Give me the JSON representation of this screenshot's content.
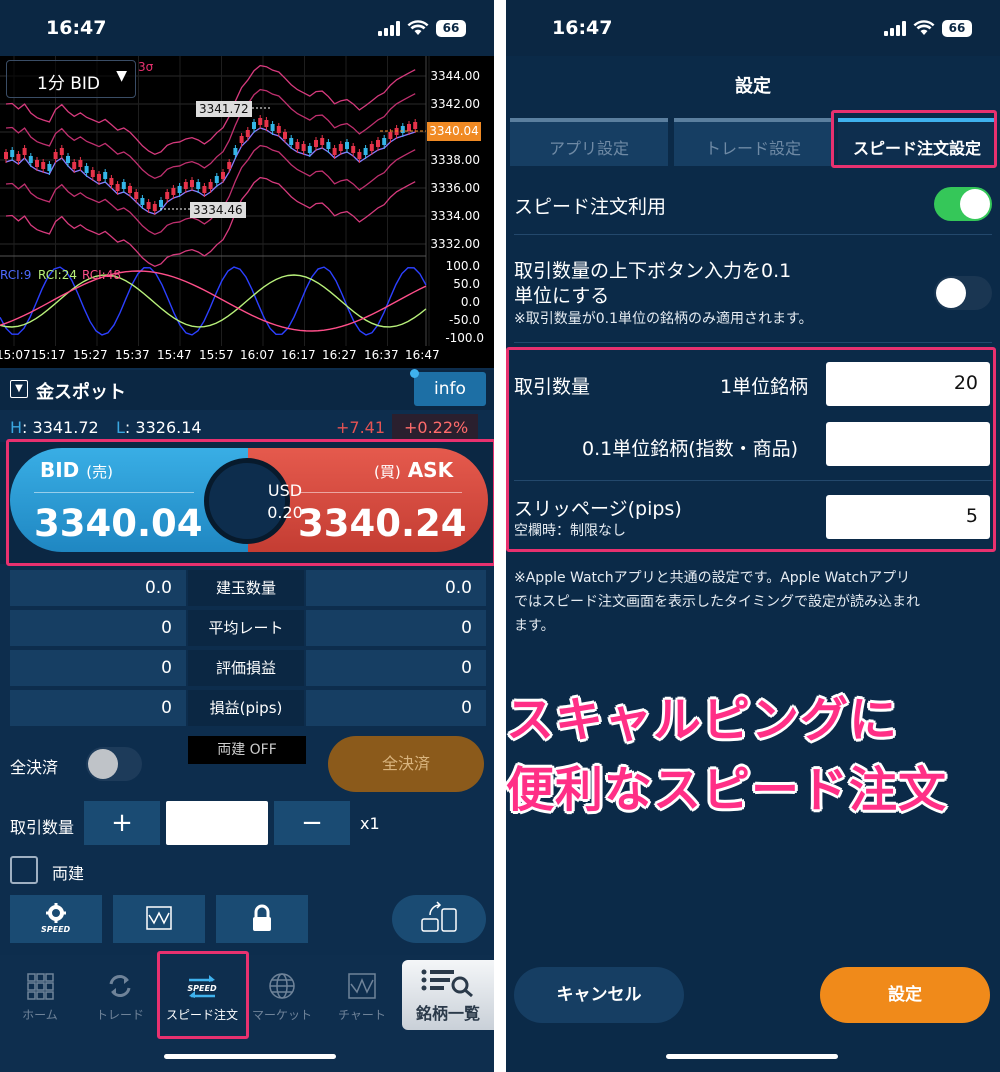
{
  "colors": {
    "bid": "#2a9fd8",
    "ask": "#d94a3e",
    "accent": "#3fb2ee",
    "highlight": "#e8316f",
    "overlay_text": "#ff2f86",
    "toggle_on": "#35c759",
    "confirm": "#f08a1a"
  },
  "left": {
    "status": {
      "time": "16:47",
      "battery": "66"
    },
    "chart": {
      "timeframe": "1分 BID",
      "indicator_label": "3σ",
      "y_ticks": [
        "3344.00",
        "3342.00",
        "3340.00",
        "3338.00",
        "3336.00",
        "3334.00",
        "3332.00"
      ],
      "current": "3340.04",
      "high_label": "3341.72",
      "low_label": "3334.46",
      "rci_ticks": [
        "100.0",
        "50.0",
        "0.0",
        "-50.0",
        "-100.0"
      ],
      "rci_legend": [
        "RCI:9",
        "RCI:24",
        "RCI:48"
      ],
      "x_ticks": [
        "15:07",
        "15:17",
        "15:27",
        "15:37",
        "15:47",
        "15:57",
        "16:07",
        "16:17",
        "16:27",
        "16:37",
        "16:47"
      ]
    },
    "symbol": {
      "name": "金スポット",
      "info": "info"
    },
    "hl": {
      "h_key": "H",
      "h_val": "3341.72",
      "l_key": "L",
      "l_val": "3326.14",
      "change": "+7.41",
      "percent": "+0.22%"
    },
    "quote": {
      "bid_label": "BID",
      "bid_side": "(売)",
      "bid": "3340.04",
      "ask_label": "ASK",
      "ask_side": "(買)",
      "ask": "3340.24",
      "spread_ccy": "USD",
      "spread": "0.20"
    },
    "positions": [
      {
        "left": "0.0",
        "label": "建玉数量",
        "right": "0.0"
      },
      {
        "left": "0",
        "label": "平均レート",
        "right": "0"
      },
      {
        "left": "0",
        "label": "評価損益",
        "right": "0"
      },
      {
        "left": "0",
        "label": "損益(pips)",
        "right": "0"
      }
    ],
    "close_all": {
      "label": "全決済",
      "hedge": "両建 OFF",
      "button": "全決済"
    },
    "qty": {
      "label": "取引数量",
      "plus": "+",
      "minus": "−",
      "multiplier": "x1"
    },
    "hedge_check": "両建",
    "speed_icon_text": "SPEED",
    "nav": [
      {
        "icon": "home-grid",
        "label": "ホーム"
      },
      {
        "icon": "trade-arrows",
        "label": "トレード"
      },
      {
        "icon": "speed-arrows",
        "label": "スピード注文"
      },
      {
        "icon": "globe",
        "label": "マーケット"
      },
      {
        "icon": "chart",
        "label": "チャート"
      }
    ],
    "symbol_list": "銘柄一覧"
  },
  "right": {
    "status": {
      "time": "16:47",
      "battery": "66"
    },
    "title": "設定",
    "tabs": [
      "アプリ設定",
      "トレード設定",
      "スピード注文設定"
    ],
    "speed_order_use": "スピード注文利用",
    "step_label_1": "取引数量の上下ボタン入力を0.1",
    "step_label_2": "単位にする",
    "step_note": "※取引数量が0.1単位の銘柄のみ適用されます。",
    "qty_label": "取引数量",
    "unit1_label": "1単位銘柄",
    "unit1_value": "20",
    "unit01_label": "0.1単位銘柄(指数・商品)",
    "unit01_value": "",
    "slippage_label": "スリッページ(pips)",
    "slippage_note": "空欄時：制限なし",
    "slippage_value": "5",
    "watch_note_1": "※Apple Watchアプリと共通の設定です。Apple Watchアプリ",
    "watch_note_2": "ではスピード注文画面を表示したタイミングで設定が読み込まれ",
    "watch_note_3": "ます。",
    "overlay_1": "スキャルピングに",
    "overlay_2": "便利なスピード注文",
    "cancel": "キャンセル",
    "confirm": "設定"
  }
}
